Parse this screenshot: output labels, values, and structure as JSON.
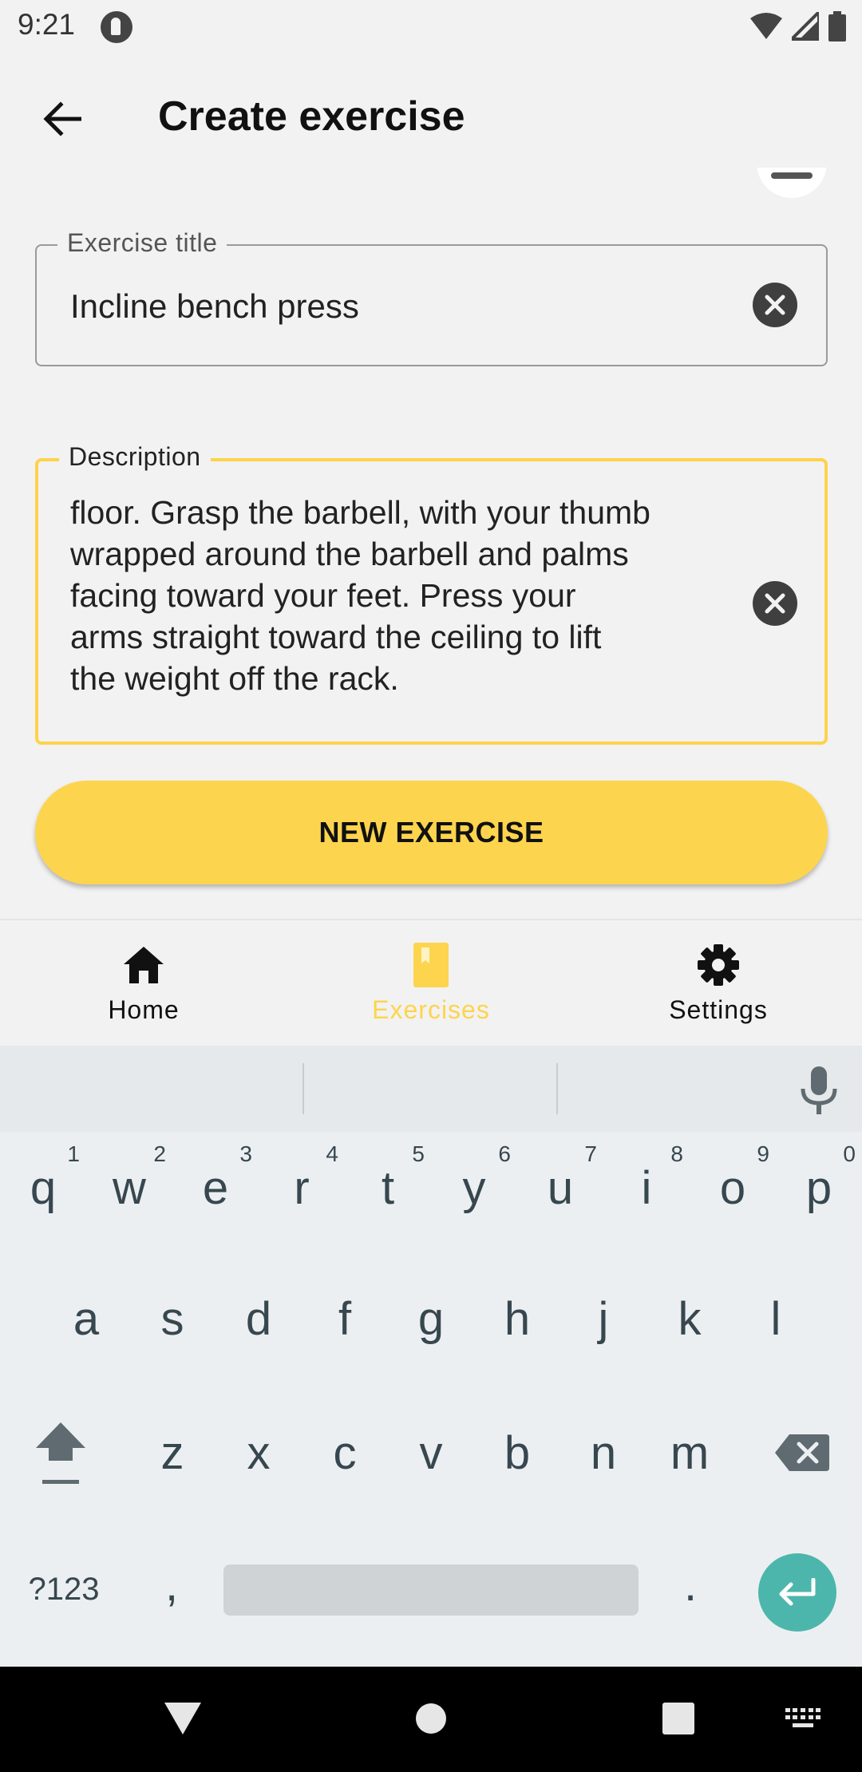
{
  "status_bar": {
    "time": "9:21"
  },
  "app_bar": {
    "title": "Create exercise"
  },
  "form": {
    "title_field": {
      "label": "Exercise title",
      "value": "Incline bench press"
    },
    "description_field": {
      "label": "Description",
      "lines": [
        "floor. Grasp the barbell, with your thumb",
        "wrapped around the barbell and palms",
        "facing toward your feet. Press your",
        "arms straight toward the ceiling to lift",
        "the weight off the rack."
      ]
    },
    "submit_label": "NEW EXERCISE"
  },
  "bottom_nav": {
    "items": [
      {
        "label": "Home",
        "icon": "home-icon",
        "active": false
      },
      {
        "label": "Exercises",
        "icon": "bookmark-book-icon",
        "active": true
      },
      {
        "label": "Settings",
        "icon": "gear-icon",
        "active": false
      }
    ],
    "active_color": "#fdd44d"
  },
  "keyboard": {
    "row1": [
      {
        "key": "q",
        "hint": "1"
      },
      {
        "key": "w",
        "hint": "2"
      },
      {
        "key": "e",
        "hint": "3"
      },
      {
        "key": "r",
        "hint": "4"
      },
      {
        "key": "t",
        "hint": "5"
      },
      {
        "key": "y",
        "hint": "6"
      },
      {
        "key": "u",
        "hint": "7"
      },
      {
        "key": "i",
        "hint": "8"
      },
      {
        "key": "o",
        "hint": "9"
      },
      {
        "key": "p",
        "hint": "0"
      }
    ],
    "row2": [
      "a",
      "s",
      "d",
      "f",
      "g",
      "h",
      "j",
      "k",
      "l"
    ],
    "row3": [
      "z",
      "x",
      "c",
      "v",
      "b",
      "n",
      "m"
    ],
    "symbols_key": "?123",
    "comma_key": ",",
    "period_key": "."
  },
  "colors": {
    "accent": "#fdd44d",
    "enter_key": "#4db6ac",
    "keyboard_bg": "#eceff1"
  }
}
